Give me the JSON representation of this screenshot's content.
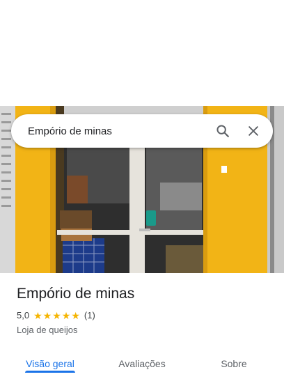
{
  "search": {
    "query": "Empório de minas"
  },
  "place": {
    "name": "Empório de minas",
    "rating": "5,0",
    "stars": 5,
    "review_count": "(1)",
    "category": "Loja de queijos"
  },
  "tabs": [
    {
      "label": "Visão geral",
      "active": true
    },
    {
      "label": "Avaliações",
      "active": false
    },
    {
      "label": "Sobre",
      "active": false
    }
  ],
  "colors": {
    "accent": "#1a73e8",
    "star": "#f5b400",
    "storefront_yellow": "#f2b416"
  },
  "icons": [
    "search-icon",
    "close-icon",
    "star-icon"
  ]
}
